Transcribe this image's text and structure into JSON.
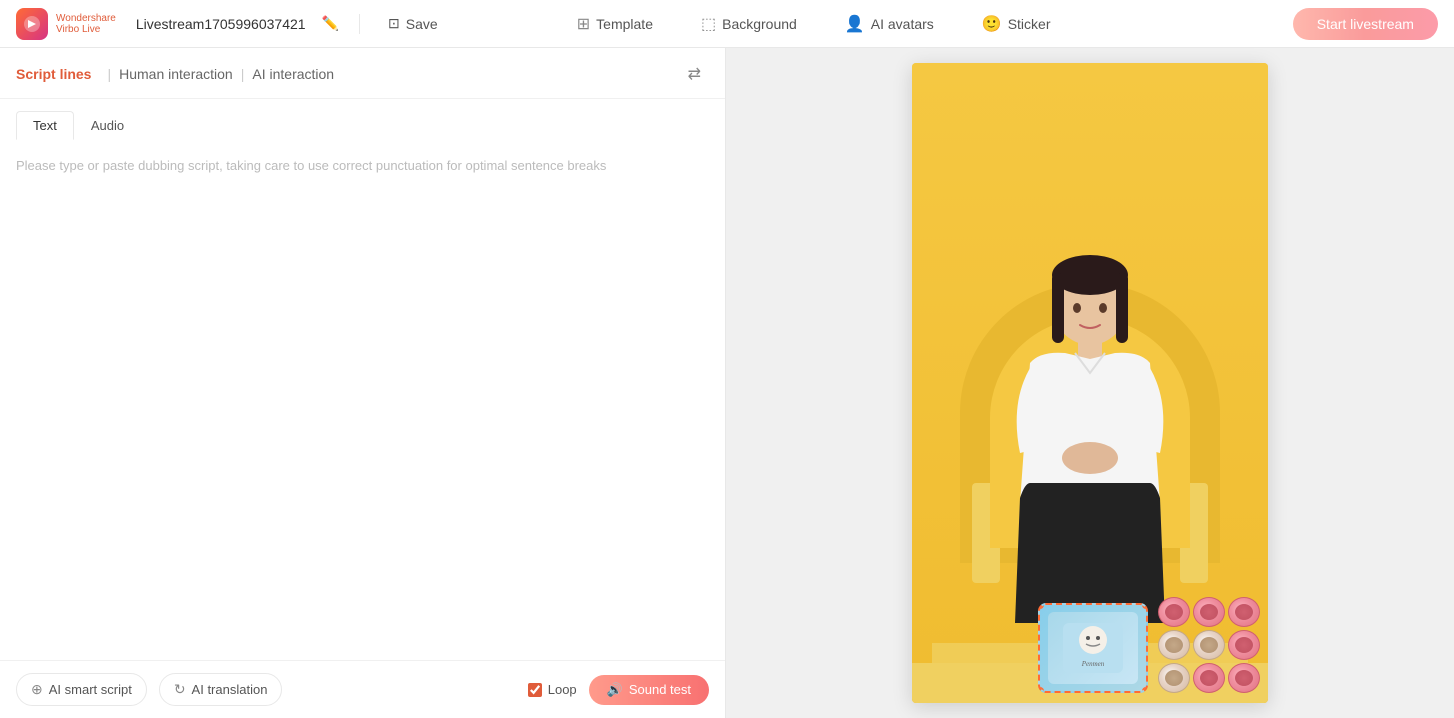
{
  "app": {
    "logo_line1": "Wondershare",
    "logo_line2": "Virbo Live",
    "project_name": "Livestream1705996037421",
    "save_label": "Save",
    "start_label": "Start livestream"
  },
  "header_nav": {
    "template_label": "Template",
    "background_label": "Background",
    "ai_avatars_label": "AI avatars",
    "sticker_label": "Sticker"
  },
  "left_panel": {
    "tab_script_lines": "Script lines",
    "tab_human_interaction": "Human interaction",
    "tab_ai_interaction": "AI interaction",
    "content_tab_text": "Text",
    "content_tab_audio": "Audio",
    "placeholder": "Please type or paste dubbing script, taking care to use correct punctuation for optimal sentence breaks",
    "ai_smart_script_label": "AI smart script",
    "ai_translation_label": "AI translation",
    "loop_label": "Loop",
    "sound_test_label": "Sound test"
  },
  "preview": {
    "label": "Preview canvas"
  },
  "colors": {
    "accent": "#e05c3a",
    "brand_gradient_start": "#ff9a8b",
    "brand_gradient_end": "#f87171",
    "yellow_bg": "#f5c842"
  }
}
